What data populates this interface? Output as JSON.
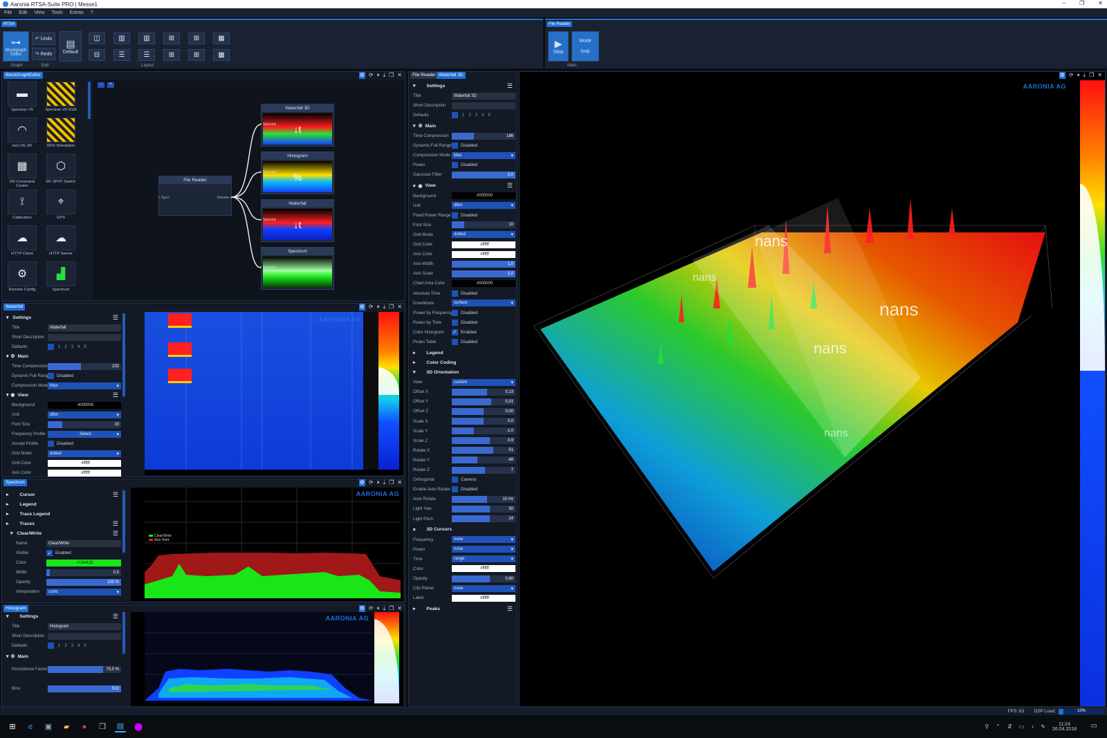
{
  "window": {
    "title": "Aaronia RTSA-Suite PRO | Messe1",
    "min": "–",
    "max": "❐",
    "close": "✕"
  },
  "menu": [
    "File",
    "Edit",
    "View",
    "Tools",
    "Extras",
    "?"
  ],
  "ribbon_left": {
    "tag": "RTSA",
    "blockgraph_label": "Blockgraph Editor",
    "undo": "Undo",
    "redo": "Redo",
    "default": "Default",
    "groups": {
      "graph": "Graph",
      "edit": "Edit",
      "layout": "Layout"
    }
  },
  "ribbon_right": {
    "tag": "File Reader",
    "stop": "Stop",
    "mode": "Mode",
    "loop": "loop",
    "group": "Main"
  },
  "blockgraph": {
    "tab": "BlockGraphEditor",
    "blocks": [
      {
        "label": "Spectran V5",
        "icon": "spectrum-analyzer-icon"
      },
      {
        "label": "Spectran V5 RSA",
        "icon": "hazard-stripe-icon"
      },
      {
        "label": "IsoLOG 3D",
        "icon": "antenna-icon"
      },
      {
        "label": "DDS-Simulation",
        "icon": "hazard-stripe-icon"
      },
      {
        "label": "DD Command Center",
        "icon": "command-center-icon"
      },
      {
        "label": "RF SP4T Switch",
        "icon": "switch-icon"
      },
      {
        "label": "Calibration",
        "icon": "calibration-icon"
      },
      {
        "label": "GPS",
        "icon": "gps-icon"
      },
      {
        "label": "HTTP Client",
        "icon": "cloud-download-icon"
      },
      {
        "label": "HTTP Server",
        "icon": "cloud-upload-icon"
      },
      {
        "label": "Remote Config",
        "icon": "cloud-gear-icon"
      },
      {
        "label": "Spectrum",
        "icon": "spectrum-icon"
      }
    ],
    "source_node": {
      "title": "File Reader",
      "in": "Sync",
      "out": "Stream"
    },
    "sink_nodes": [
      {
        "title": "Waterfall 3D",
        "port": "Spectra"
      },
      {
        "title": "Histogram",
        "port": "Spectra"
      },
      {
        "title": "Waterfall",
        "port": "Spectra"
      },
      {
        "title": "Spectrum",
        "port": "Spectra"
      }
    ]
  },
  "waterfall": {
    "tab": "Waterfall",
    "settings": "Settings",
    "title_label": "Title",
    "title_value": "Waterfall",
    "short_desc": "Short Description",
    "defaults": "Defaults",
    "main": "Main",
    "time_compression": "Time Compression",
    "time_compression_val": "232",
    "dyn_full_range": "Dynamic Full Range",
    "disabled": "Disabled",
    "compression_mode": "Compression Mode",
    "compression_val": "Max",
    "view": "View",
    "background": "Background",
    "background_val": "#000000",
    "unit": "Unit",
    "unit_val": "dBm",
    "font_size": "Font Size",
    "font_size_val": "10",
    "freq_profile": "Frequency Profile",
    "select": "Select",
    "accept_profile": "Accept Profile",
    "grid_mode": "Grid Mode",
    "grid_val": "dotted",
    "grid_color": "Grid Color",
    "grid_color_val": "#ffffff",
    "axis_color": "Axis Color",
    "axis_color_val": "#ffffff"
  },
  "spectrum": {
    "tab": "Spectrum",
    "cursor": "Cursor",
    "legend": "Legend",
    "trace_legend": "Trace Legend",
    "traces": "Traces",
    "clear_write": "Clear/Write",
    "name": "Name",
    "name_val": "Clear/Write",
    "visible": "Visible",
    "enabled": "Enabled",
    "color": "Color",
    "color_val": "#19e619",
    "width": "Width",
    "width_val": "0,5",
    "opacity": "Opacity",
    "opacity_val": "100 %",
    "interpolation": "Interpolation",
    "interp_val": "cubic",
    "legend_items": [
      "Clear/Write",
      "Max Hold"
    ]
  },
  "histogram": {
    "tab": "Histogram",
    "settings": "Settings",
    "title_label": "Title",
    "title_value": "Histogram",
    "short_desc": "Short Description",
    "defaults": "Defaults",
    "main": "Main",
    "persistence": "Persistence Factor",
    "persistence_val": "75,0 %",
    "bins": "Bins",
    "bins_val": "512"
  },
  "wf3d_settings": {
    "tabs": [
      "File Reader",
      "Waterfall 3D"
    ],
    "settings": "Settings",
    "title_label": "Title",
    "title_value": "Waterfall 3D",
    "short_desc": "Short Description",
    "defaults": "Defaults",
    "main": "Main",
    "rows_main": [
      {
        "label": "Time Compression",
        "kind": "slider",
        "value": "186",
        "fill": 0.35
      },
      {
        "label": "Dynamic Full Range",
        "kind": "check",
        "value": "Disabled"
      },
      {
        "label": "Compression Mode",
        "kind": "drop",
        "value": "Max"
      },
      {
        "label": "Power",
        "kind": "check",
        "value": "Disabled"
      },
      {
        "label": "Gaussian Filter",
        "kind": "slider",
        "value": "0,0",
        "fill": 1.0
      }
    ],
    "view": "View",
    "rows_view": [
      {
        "label": "Background",
        "kind": "black",
        "value": "#000000"
      },
      {
        "label": "Unit",
        "kind": "drop",
        "value": "dBm"
      },
      {
        "label": "Fixed Power Range",
        "kind": "check",
        "value": "Disabled"
      },
      {
        "label": "Font Size",
        "kind": "slider",
        "value": "10",
        "fill": 0.2
      },
      {
        "label": "Grid Mode",
        "kind": "drop",
        "value": "dotted"
      },
      {
        "label": "Grid Color",
        "kind": "white",
        "value": "#ffffff"
      },
      {
        "label": "Axis Color",
        "kind": "white",
        "value": "#ffffff"
      },
      {
        "label": "Axis Width",
        "kind": "slider",
        "value": "1,0",
        "fill": 1.0
      },
      {
        "label": "Axis Scale",
        "kind": "slider",
        "value": "1,0",
        "fill": 1.0
      },
      {
        "label": "Chart Area Color",
        "kind": "black",
        "value": "#000000"
      },
      {
        "label": "Absolute Time",
        "kind": "check",
        "value": "Disabled"
      },
      {
        "label": "DrawMode",
        "kind": "drop",
        "value": "surface"
      },
      {
        "label": "Power by Frequency",
        "kind": "check",
        "value": "Disabled"
      },
      {
        "label": "Power by Time",
        "kind": "check",
        "value": "Disabled"
      },
      {
        "label": "Color Histogram",
        "kind": "checked",
        "value": "Enabled"
      },
      {
        "label": "Peaks Table",
        "kind": "check",
        "value": "Disabled"
      }
    ],
    "legend": "Legend",
    "color_coding": "Color Coding",
    "orientation": "3D Orientation",
    "rows_orient": [
      {
        "label": "View",
        "kind": "drop",
        "value": "custom"
      },
      {
        "label": "Offset X",
        "kind": "slider",
        "value": "0,13",
        "fill": 0.55
      },
      {
        "label": "Offset Y",
        "kind": "slider",
        "value": "0,31",
        "fill": 0.62
      },
      {
        "label": "Offset Z",
        "kind": "slider",
        "value": "0,00",
        "fill": 0.5
      },
      {
        "label": "Scale X",
        "kind": "slider",
        "value": "0,0",
        "fill": 0.5
      },
      {
        "label": "Scale Y",
        "kind": "slider",
        "value": "-1,0",
        "fill": 0.35
      },
      {
        "label": "Scale Z",
        "kind": "slider",
        "value": "0,9",
        "fill": 0.6
      },
      {
        "label": "Rotate X",
        "kind": "slider",
        "value": "51",
        "fill": 0.65
      },
      {
        "label": "Rotate Y",
        "kind": "slider",
        "value": "-48",
        "fill": 0.4
      },
      {
        "label": "Rotate Z",
        "kind": "slider",
        "value": "7",
        "fill": 0.52
      },
      {
        "label": "Orthogonal",
        "kind": "check",
        "value": "Camera"
      },
      {
        "label": "Enable Auto Rotate",
        "kind": "check",
        "value": "Disabled"
      },
      {
        "label": "Auto Rotate",
        "kind": "slider",
        "value": "10 Hz",
        "fill": 0.55
      },
      {
        "label": "Light Yaw",
        "kind": "slider",
        "value": "50",
        "fill": 0.6
      },
      {
        "label": "Light Pitch",
        "kind": "slider",
        "value": "24",
        "fill": 0.6
      }
    ],
    "cursors": "3D Cursors",
    "rows_cursor": [
      {
        "label": "Frequency",
        "kind": "drop",
        "value": "none"
      },
      {
        "label": "Power",
        "kind": "drop",
        "value": "none"
      },
      {
        "label": "Time",
        "kind": "drop",
        "value": "range"
      },
      {
        "label": "Color",
        "kind": "white",
        "value": "#ffffff"
      },
      {
        "label": "Opacity",
        "kind": "slider",
        "value": "0,60",
        "fill": 0.6
      },
      {
        "label": "Clip Planet",
        "kind": "drop",
        "value": "none"
      },
      {
        "label": "Label",
        "kind": "white",
        "value": "#ffffff"
      }
    ],
    "peaks": "Peaks"
  },
  "wf3d_view": {
    "logo": "AARONIA AG",
    "plane_labels": [
      "nans",
      "nans",
      "nans",
      "nans",
      "nans"
    ]
  },
  "status": {
    "fps": "FPS: 63",
    "dsp": "DSP Load:",
    "dsp_val": "10%",
    "dsp_level": 0.1
  },
  "taskbar": {
    "time": "11:24",
    "date": "26.04.2018"
  }
}
